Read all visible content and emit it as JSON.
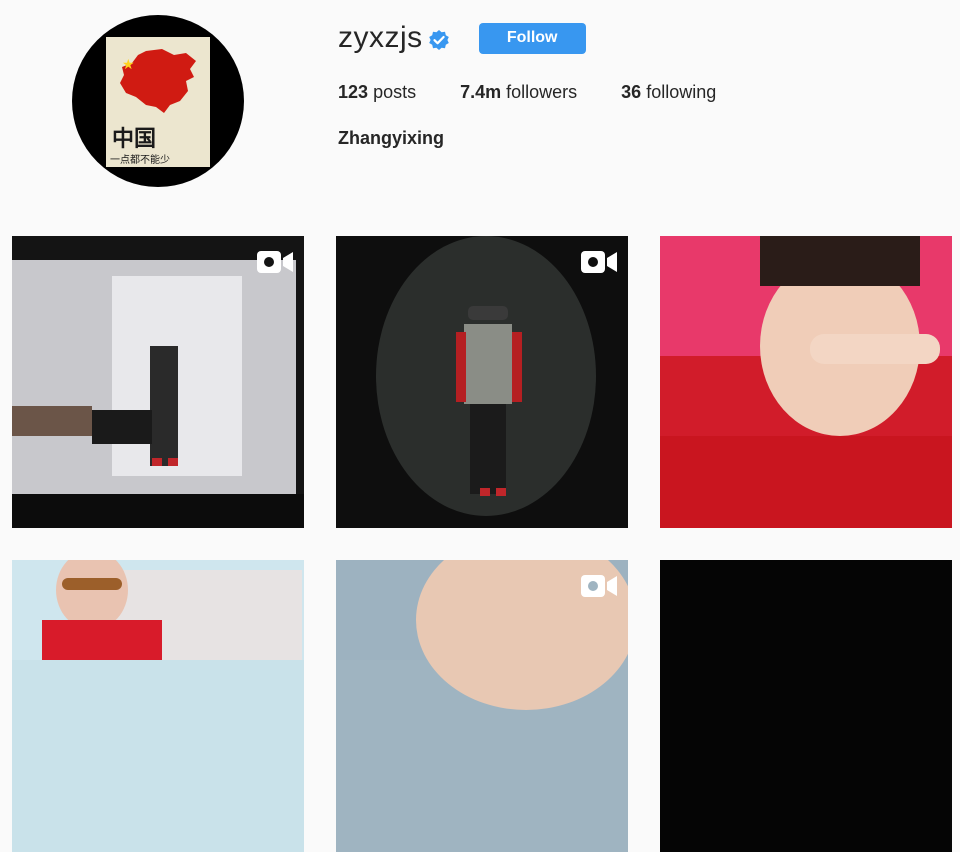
{
  "profile": {
    "username": "zyxzjs",
    "verified_icon": "verified-badge-icon",
    "follow_label": "Follow",
    "posts_count": "123",
    "posts_label": "posts",
    "followers_count": "7.4m",
    "followers_label": "followers",
    "following_count": "36",
    "following_label": "following",
    "full_name": "Zhangyixing",
    "avatar": {
      "title_text": "中国",
      "caption_text": "一点都不能少"
    }
  },
  "colors": {
    "follow_button": "#3897f0",
    "background": "#fafafa",
    "verified_badge": "#3897f0"
  },
  "posts": [
    {
      "type": "video",
      "icon": "video-camera-icon"
    },
    {
      "type": "video",
      "icon": "video-camera-icon"
    },
    {
      "type": "image"
    },
    {
      "type": "image"
    },
    {
      "type": "video",
      "icon": "video-camera-icon"
    },
    {
      "type": "image"
    }
  ]
}
